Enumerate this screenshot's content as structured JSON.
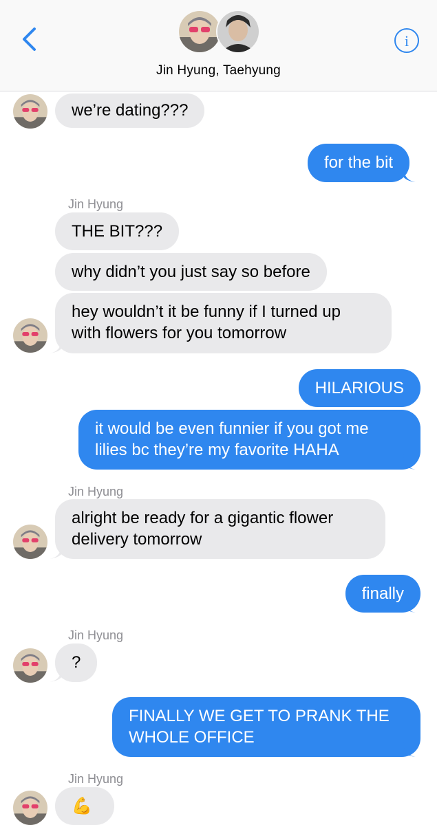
{
  "header": {
    "title": "Jin Hyung, Taehyung",
    "back_icon": "chevron-left-icon",
    "info_icon": "info-circle-icon",
    "info_glyph": "i",
    "accent": "#2f87ef"
  },
  "messages": [
    {
      "from": "in",
      "text": "we’re dating???"
    },
    {
      "from": "out",
      "text": "for the bit"
    },
    {
      "sender": "Jin Hyung"
    },
    {
      "from": "in",
      "text": "THE BIT???"
    },
    {
      "from": "in",
      "text": "why didn’t you just say so before"
    },
    {
      "from": "in",
      "lines": [
        "hey wouldn’t it be funny if I turned up",
        "with flowers for you tomorrow"
      ]
    },
    {
      "from": "out",
      "text": "HILARIOUS"
    },
    {
      "from": "out",
      "lines": [
        "it would be even funnier if you got me",
        "lilies bc they’re my favorite HAHA"
      ]
    },
    {
      "sender": "Jin Hyung"
    },
    {
      "from": "in",
      "lines": [
        "alright be ready for a gigantic flower",
        "delivery tomorrow"
      ]
    },
    {
      "from": "out",
      "text": "finally"
    },
    {
      "sender": "Jin Hyung"
    },
    {
      "from": "in",
      "text": "?"
    },
    {
      "from": "out",
      "lines": [
        "FINALLY WE GET TO PRANK THE",
        "WHOLE OFFICE"
      ]
    },
    {
      "sender": "Jin Hyung"
    },
    {
      "from": "in",
      "text": "💪"
    }
  ],
  "senders": {
    "s1": "Jin Hyung",
    "s2": "Jin Hyung",
    "s3": "Jin Hyung",
    "s4": "Jin Hyung"
  },
  "bubbles": {
    "b1": "we’re dating???",
    "b2": "for the bit",
    "b3": "THE BIT???",
    "b4": "why didn’t you just say so before",
    "b5a": "hey wouldn’t it be funny if I turned up",
    "b5b": "with flowers for you tomorrow",
    "b6": "HILARIOUS",
    "b7a": "it would be even funnier if you got me",
    "b7b": "lilies bc they’re my favorite HAHA",
    "b8a": "alright be ready for a gigantic flower",
    "b8b": "delivery tomorrow",
    "b9": "finally",
    "b10": "?",
    "b11a": "FINALLY WE GET TO PRANK THE",
    "b11b": "WHOLE OFFICE",
    "b12": "💪"
  }
}
